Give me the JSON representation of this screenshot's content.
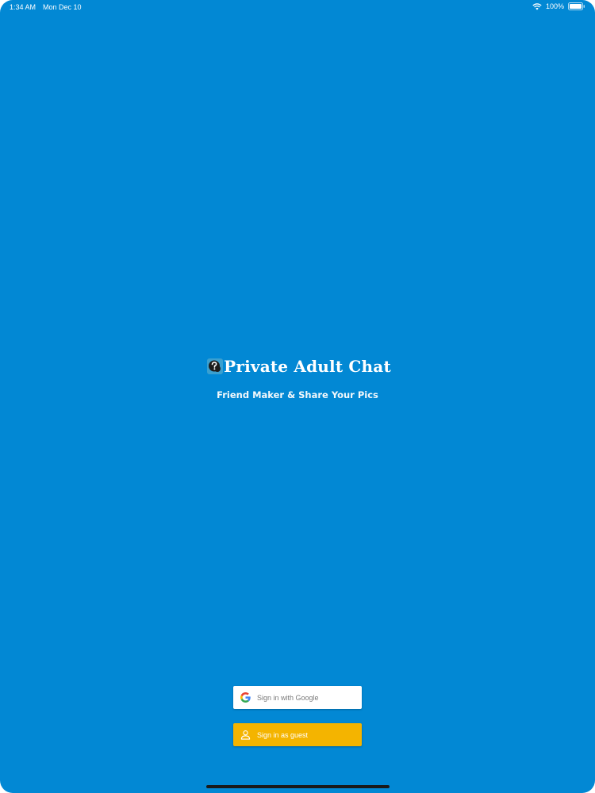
{
  "status_bar": {
    "time": "1:34 AM",
    "date": "Mon Dec 10",
    "battery": "100%"
  },
  "app": {
    "title": "Private Adult Chat",
    "subtitle": "Friend Maker & Share Your Pics",
    "logo_icon": "chat-logo-icon"
  },
  "buttons": {
    "google": {
      "label": "Sign in with Google",
      "icon": "google-g-icon"
    },
    "guest": {
      "label": "Sign in as guest",
      "icon": "person-icon"
    }
  },
  "colors": {
    "background": "#0288d4",
    "guest_button": "#f4b400",
    "google_button": "#ffffff"
  }
}
